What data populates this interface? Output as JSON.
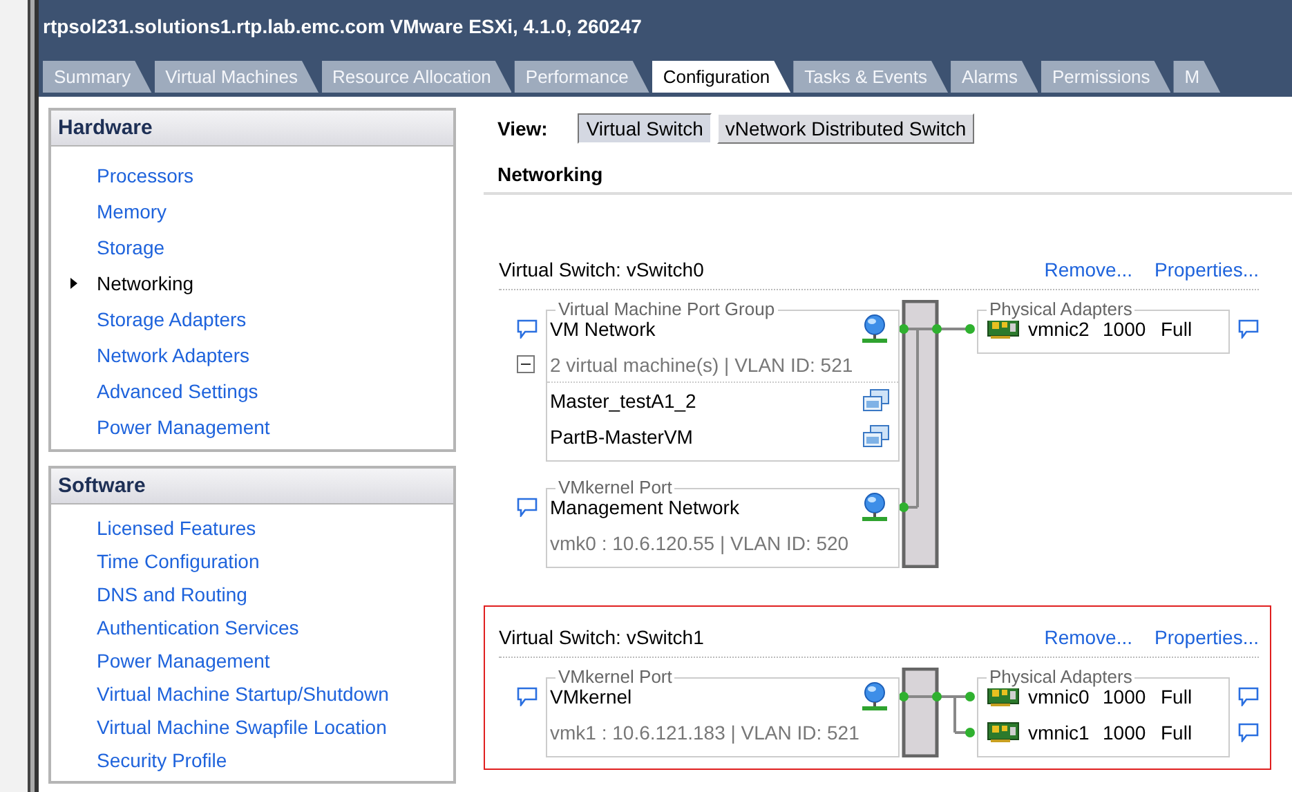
{
  "window": {
    "title": "rtpsol231.solutions1.rtp.lab.emc.com VMware ESXi, 4.1.0, 260247"
  },
  "tabs": [
    {
      "label": "Summary",
      "selected": false
    },
    {
      "label": "Virtual Machines",
      "selected": false
    },
    {
      "label": "Resource Allocation",
      "selected": false
    },
    {
      "label": "Performance",
      "selected": false
    },
    {
      "label": "Configuration",
      "selected": true
    },
    {
      "label": "Tasks & Events",
      "selected": false
    },
    {
      "label": "Alarms",
      "selected": false
    },
    {
      "label": "Permissions",
      "selected": false
    },
    {
      "label": "M",
      "selected": false
    }
  ],
  "sidebar": {
    "sections": [
      {
        "title": "Hardware",
        "items": [
          {
            "label": "Processors",
            "selected": false
          },
          {
            "label": "Memory",
            "selected": false
          },
          {
            "label": "Storage",
            "selected": false
          },
          {
            "label": "Networking",
            "selected": true
          },
          {
            "label": "Storage Adapters",
            "selected": false
          },
          {
            "label": "Network Adapters",
            "selected": false
          },
          {
            "label": "Advanced Settings",
            "selected": false
          },
          {
            "label": "Power Management",
            "selected": false
          }
        ]
      },
      {
        "title": "Software",
        "items": [
          {
            "label": "Licensed Features",
            "selected": false
          },
          {
            "label": "Time Configuration",
            "selected": false
          },
          {
            "label": "DNS and Routing",
            "selected": false
          },
          {
            "label": "Authentication Services",
            "selected": false
          },
          {
            "label": "Power Management",
            "selected": false
          },
          {
            "label": "Virtual Machine Startup/Shutdown",
            "selected": false
          },
          {
            "label": "Virtual Machine Swapfile Location",
            "selected": false
          },
          {
            "label": "Security Profile",
            "selected": false
          }
        ]
      }
    ]
  },
  "view": {
    "label": "View:",
    "options": [
      {
        "label": "Virtual Switch",
        "selected": true
      },
      {
        "label": "vNetwork Distributed Switch",
        "selected": false
      }
    ]
  },
  "heading": "Networking",
  "switches": [
    {
      "title": "Virtual Switch: vSwitch0",
      "highlighted": false,
      "actions": [
        "Remove...",
        "Properties..."
      ],
      "port_groups": [
        {
          "kind": "vm",
          "legend": "Virtual Machine Port Group",
          "name": "VM Network",
          "detail": "2 virtual machine(s) | VLAN ID: 521",
          "expanded": true,
          "vms": [
            "Master_testA1_2",
            "PartB-MasterVM"
          ]
        },
        {
          "kind": "vmkernel",
          "legend": "VMkernel Port",
          "name": "Management Network",
          "detail": "vmk0 : 10.6.120.55 | VLAN ID: 520"
        }
      ],
      "adapters_legend": "Physical Adapters",
      "adapters": [
        {
          "name": "vmnic2",
          "speed": "1000",
          "duplex": "Full"
        }
      ]
    },
    {
      "title": "Virtual Switch: vSwitch1",
      "highlighted": true,
      "actions": [
        "Remove...",
        "Properties..."
      ],
      "port_groups": [
        {
          "kind": "vmkernel",
          "legend": "VMkernel Port",
          "name": "VMkernel",
          "detail": "vmk1 : 10.6.121.183 | VLAN ID: 521"
        }
      ],
      "adapters_legend": "Physical Adapters",
      "adapters": [
        {
          "name": "vmnic0",
          "speed": "1000",
          "duplex": "Full"
        },
        {
          "name": "vmnic1",
          "speed": "1000",
          "duplex": "Full"
        }
      ]
    }
  ]
}
